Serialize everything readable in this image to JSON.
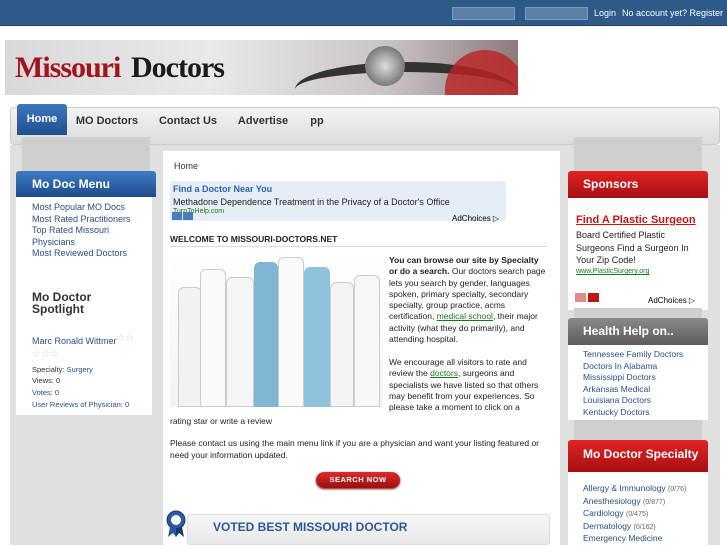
{
  "topbar": {
    "login": "Login",
    "register": "No account yet? Register"
  },
  "logo": {
    "part1": "Missouri",
    "part2": "Doctors"
  },
  "nav": {
    "items": [
      "Home",
      "MO Doctors",
      "Contact Us",
      "Advertise",
      "pp"
    ]
  },
  "left_menu": {
    "title": "Mo Doc Menu",
    "links": [
      "Most Popular MO Docs",
      "Most Rated Practitioners",
      "Top Rated Missouri Physicians",
      "Most Reviewed Doctors"
    ]
  },
  "spotlight": {
    "title_line1": "Mo Doctor",
    "title_line2": "Spotlight",
    "name": "Marc Ronald Wittmer",
    "specialty_label": "Specialty:",
    "specialty": "Surgery",
    "views": "Views: 0",
    "votes": "Votes: 0",
    "reviews": "User Reviews of Physician: 0"
  },
  "content": {
    "breadcrumb": "Home",
    "ad": {
      "title": "Find a Doctor Near You",
      "text": "Methadone Dependence Treatment in the Privacy of a Doctor's Office",
      "url": "TurnToHelp.com",
      "adchoices": "AdChoices"
    },
    "welcome": "WELCOME TO MISSOURI-DOCTORS.NET",
    "intro_bold": "You can browse our site by Specialty or do a search.",
    "intro_rest": " Our doctors search page lets you search by gender, languages spoken, primary specialty, secondary specialty, group practice, acms certification, ",
    "intro_link": "medical school",
    "intro_end": ", their major activity (what they do primarily), and attending hospital.",
    "encourage_a": "We encourage all visitors to rate and review the ",
    "encourage_link": "doctors",
    "encourage_b": ", surgeons and specialists we have listed so that others may benefit from your experiences. So please take a moment to click on a",
    "rating": "rating star or write a review",
    "contact": "Please contact us using the main menu link if you are a physician and want your listing featured or need your information updated.",
    "search_button": "Search Now",
    "voted": "VOTED BEST MISSOURI DOCTOR"
  },
  "sponsors": {
    "title": "Sponsors",
    "ad_title": "Find A Plastic Surgeon",
    "ad_text": "Board Certified Plastic Surgeons Find a Surgeon In Your Zip Code!",
    "ad_url": "www.PlasticSurgery.org",
    "adchoices": "AdChoices"
  },
  "health_help": {
    "title": "Health Help on..",
    "links": [
      "Tennessee Family Doctors",
      "Doctors In Alabama",
      "Mississippi Doctors",
      "Arkansas Medical",
      "Louisiana Doctors",
      "Kentucky Doctors"
    ]
  },
  "specialty": {
    "title": "Mo Doctor Specialty",
    "items": [
      {
        "name": "Allergy & Immunology",
        "count": "(0/76)"
      },
      {
        "name": "Anesthesiology",
        "count": "(0/877)"
      },
      {
        "name": "Cardiology",
        "count": "(0/475)"
      },
      {
        "name": "Dermatology",
        "count": "(0/162)"
      },
      {
        "name": "Emergency Medicine",
        "count": ""
      }
    ]
  },
  "colors": {
    "topbar": "#2e5a8a",
    "accent_blue": "#1e4c8b",
    "accent_red": "#c41515"
  }
}
